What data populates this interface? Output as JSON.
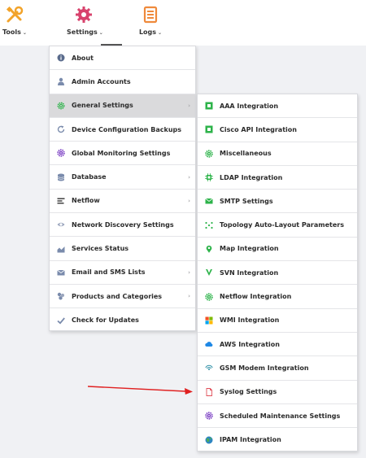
{
  "topbar": {
    "tools_label": "Tools",
    "settings_label": "Settings",
    "logs_label": "Logs",
    "tools_icon": "wrench-screwdriver-icon",
    "settings_icon": "gear-icon",
    "logs_icon": "document-icon",
    "colors": {
      "tools": "#f2a32a",
      "settings": "#d8436d",
      "logs": "#ef8a3c"
    }
  },
  "settings_menu": {
    "items": [
      {
        "label": "About",
        "icon": "info-icon",
        "submenu": false
      },
      {
        "label": "Admin Accounts",
        "icon": "user-icon",
        "submenu": false
      },
      {
        "label": "General Settings",
        "icon": "gear-icon",
        "submenu": true,
        "active": true
      },
      {
        "label": "Device Configuration Backups",
        "icon": "refresh-icon",
        "submenu": false
      },
      {
        "label": "Global Monitoring Settings",
        "icon": "gear-icon",
        "submenu": false
      },
      {
        "label": "Database",
        "icon": "database-icon",
        "submenu": true
      },
      {
        "label": "Netflow",
        "icon": "netflow-icon",
        "submenu": true
      },
      {
        "label": "Network Discovery Settings",
        "icon": "eye-icon",
        "submenu": false
      },
      {
        "label": "Services Status",
        "icon": "chart-icon",
        "submenu": false
      },
      {
        "label": "Email and SMS Lists",
        "icon": "envelope-icon",
        "submenu": true
      },
      {
        "label": "Products and Categories",
        "icon": "boxes-icon",
        "submenu": true
      },
      {
        "label": "Check for Updates",
        "icon": "check-icon",
        "submenu": false
      }
    ]
  },
  "general_settings_menu": {
    "items": [
      {
        "label": "AAA Integration",
        "icon": "square-icon"
      },
      {
        "label": "Cisco API Integration",
        "icon": "square-icon"
      },
      {
        "label": "Miscellaneous",
        "icon": "gear-icon"
      },
      {
        "label": "LDAP Integration",
        "icon": "chip-icon"
      },
      {
        "label": "SMTP Settings",
        "icon": "envelope-icon"
      },
      {
        "label": "Topology Auto-Layout Parameters",
        "icon": "dots-icon"
      },
      {
        "label": "Map Integration",
        "icon": "map-pin-icon"
      },
      {
        "label": "SVN Integration",
        "icon": "svn-icon"
      },
      {
        "label": "Netflow Integration",
        "icon": "gear-icon"
      },
      {
        "label": "WMI Integration",
        "icon": "windows-icon"
      },
      {
        "label": "AWS Integration",
        "icon": "cloud-icon"
      },
      {
        "label": "GSM Modem Integration",
        "icon": "signal-icon"
      },
      {
        "label": "Syslog Settings",
        "icon": "file-icon"
      },
      {
        "label": "Scheduled Maintenance Settings",
        "icon": "gear-icon"
      },
      {
        "label": "IPAM Integration",
        "icon": "globe-icon"
      }
    ]
  }
}
